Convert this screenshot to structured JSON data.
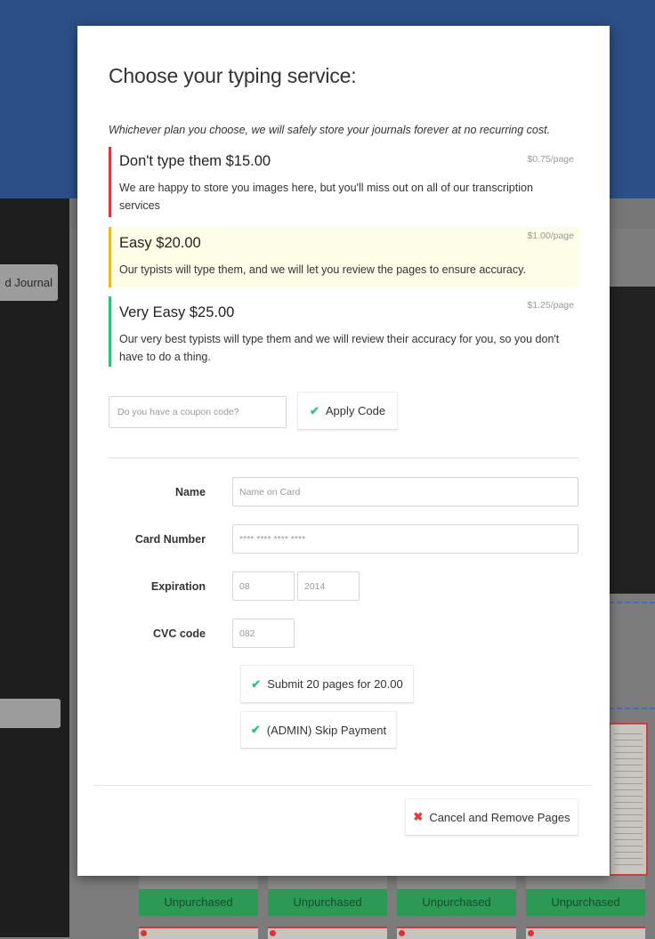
{
  "background": {
    "journal_button_label": "d Journal",
    "card_status_label": "Unpurchased"
  },
  "modal": {
    "title": "Choose your typing service:",
    "intro": "Whichever plan you choose, we will safely store your journals forever at no recurring cost.",
    "plans": [
      {
        "name": "Don't type them $15.00",
        "rate": "$0.75/page",
        "description": "We are happy to store you images here, but you'll miss out on all of our transcription services",
        "accent": "#d9363e"
      },
      {
        "name": "Easy $20.00",
        "rate": "$1.00/page",
        "description": "Our typists will type them, and we will let you review the pages to ensure accuracy.",
        "accent": "#e8b92b"
      },
      {
        "name": "Very Easy $25.00",
        "rate": "$1.25/page",
        "description": "Our very best typists will type them and we will review their accuracy for you, so you don't have to do a thing.",
        "accent": "#2fc27a"
      }
    ],
    "coupon": {
      "placeholder": "Do you have a coupon code?",
      "apply_label": "Apply Code"
    },
    "payment": {
      "name_label": "Name",
      "name_placeholder": "Name on Card",
      "card_label": "Card Number",
      "card_placeholder": "**** **** **** ****",
      "expiration_label": "Expiration",
      "exp_month_placeholder": "08",
      "exp_year_placeholder": "2014",
      "cvc_label": "CVC code",
      "cvc_placeholder": "082",
      "submit_label": "Submit 20 pages for 20.00",
      "admin_skip_label": "(ADMIN) Skip Payment"
    },
    "cancel_label": "Cancel and Remove Pages"
  }
}
